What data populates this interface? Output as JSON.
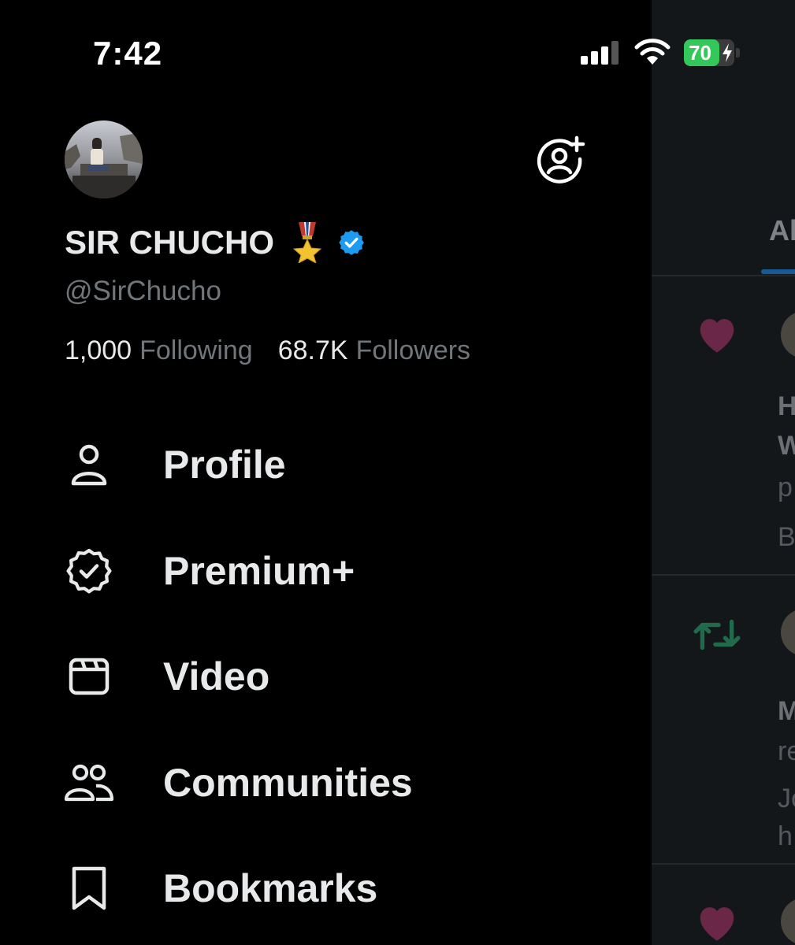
{
  "status_bar": {
    "time": "7:42",
    "battery_level": "70",
    "battery_fraction": 0.7,
    "signal_bars_active": 3
  },
  "drawer": {
    "display_name": "SIR CHUCHO",
    "handle": "@SirChucho",
    "following_count": "1,000",
    "following_label": "Following",
    "followers_count": "68.7K",
    "followers_label": "Followers",
    "menu": [
      {
        "label": "Profile",
        "icon": "person-icon"
      },
      {
        "label": "Premium+",
        "icon": "verified-badge-icon"
      },
      {
        "label": "Video",
        "icon": "video-icon"
      },
      {
        "label": "Communities",
        "icon": "communities-icon"
      },
      {
        "label": "Bookmarks",
        "icon": "bookmark-icon"
      }
    ]
  },
  "timeline": {
    "tab_label": "Al",
    "items": [
      {
        "icon": "heart-icon",
        "lines": [
          "H",
          "W",
          "p",
          "B"
        ]
      },
      {
        "icon": "retweet-icon",
        "lines": [
          "M",
          "re",
          "Jo",
          "h"
        ]
      },
      {
        "icon": "heart-icon",
        "lines": []
      }
    ]
  },
  "colors": {
    "background": "#000000",
    "text_primary": "#e7e9ea",
    "text_secondary": "#71767b",
    "verified_blue": "#1d9bf0",
    "battery_green": "#34c759",
    "heart": "#6b2748",
    "retweet": "#1f6b4b"
  }
}
